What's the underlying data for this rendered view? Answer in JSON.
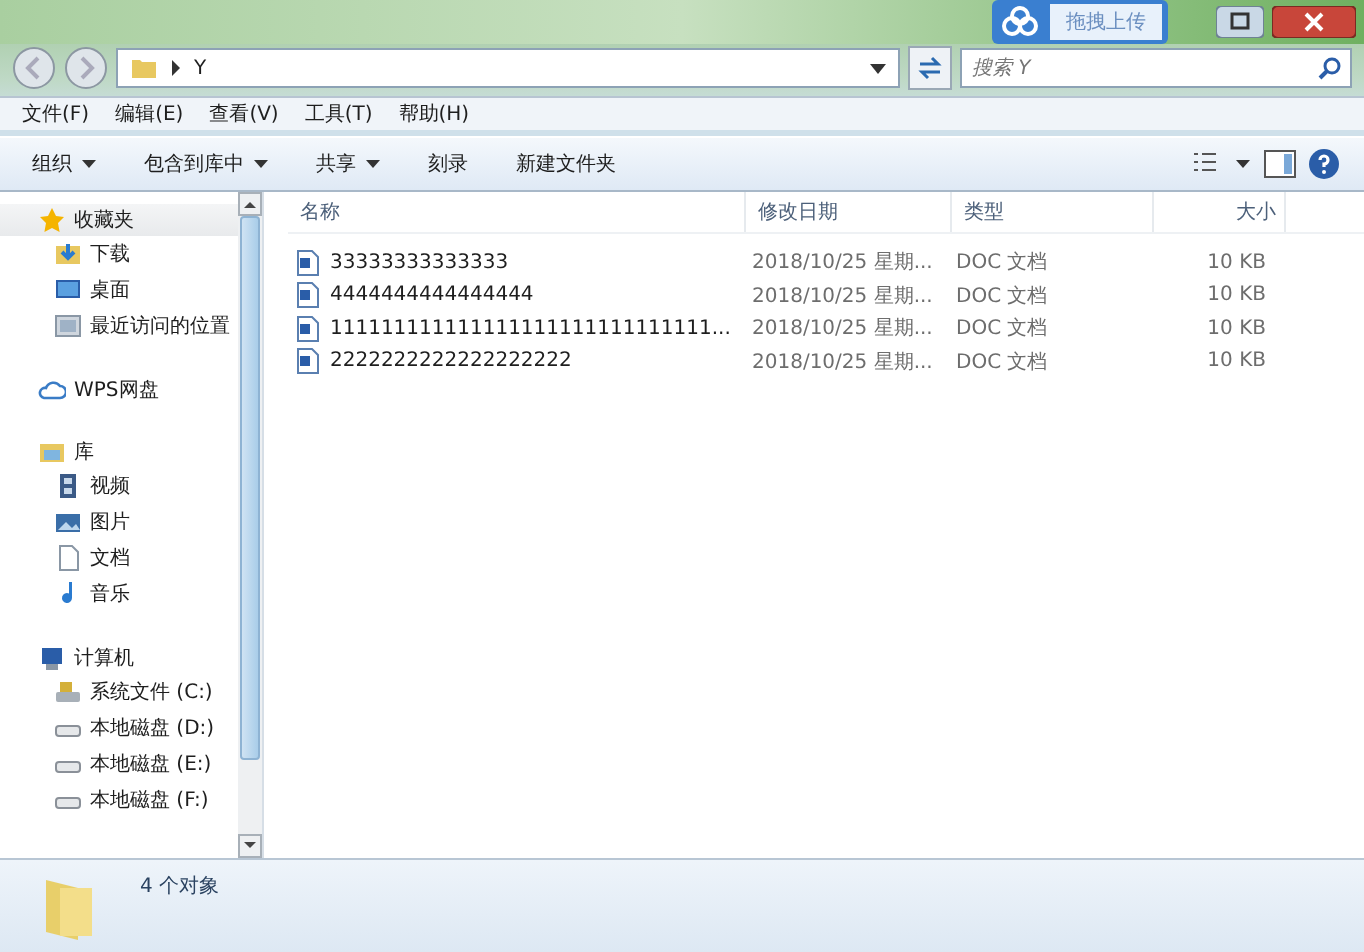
{
  "upload_widget": {
    "label": "拖拽上传"
  },
  "address_bar": {
    "path": "Y"
  },
  "search": {
    "placeholder": "搜索 Y"
  },
  "menu_bar": [
    "文件(F)",
    "编辑(E)",
    "查看(V)",
    "工具(T)",
    "帮助(H)"
  ],
  "toolbar": [
    {
      "label": "组织",
      "dropdown": true
    },
    {
      "label": "包含到库中",
      "dropdown": true
    },
    {
      "label": "共享",
      "dropdown": true
    },
    {
      "label": "刻录",
      "dropdown": false
    },
    {
      "label": "新建文件夹",
      "dropdown": false
    }
  ],
  "sidebar": [
    {
      "kind": "group",
      "label": "收藏夹",
      "selected": true,
      "children": [
        {
          "label": "下载"
        },
        {
          "label": "桌面"
        },
        {
          "label": "最近访问的位置"
        }
      ]
    },
    {
      "kind": "group",
      "label": "WPS网盘",
      "selected": false
    },
    {
      "kind": "group",
      "label": "库",
      "selected": false,
      "children": [
        {
          "label": "视频"
        },
        {
          "label": "图片"
        },
        {
          "label": "文档"
        },
        {
          "label": "音乐"
        }
      ]
    },
    {
      "kind": "group",
      "label": "计算机",
      "selected": false,
      "children": [
        {
          "label": "系统文件 (C:)"
        },
        {
          "label": "本地磁盘 (D:)"
        },
        {
          "label": "本地磁盘 (E:)"
        },
        {
          "label": "本地磁盘 (F:)"
        }
      ]
    }
  ],
  "table": {
    "columns": [
      "名称",
      "修改日期",
      "类型",
      "大小"
    ],
    "rows": [
      [
        "33333333333333",
        "2018/10/25 星期...",
        "DOC 文档",
        "10 KB"
      ],
      [
        "4444444444444444",
        "2018/10/25 星期...",
        "DOC 文档",
        "10 KB"
      ],
      [
        "111111111111111111111111111111...",
        "2018/10/25 星期...",
        "DOC 文档",
        "10 KB"
      ],
      [
        "2222222222222222222",
        "2018/10/25 星期...",
        "DOC 文档",
        "10 KB"
      ]
    ]
  },
  "status_bar": {
    "text": "4 个对象"
  }
}
